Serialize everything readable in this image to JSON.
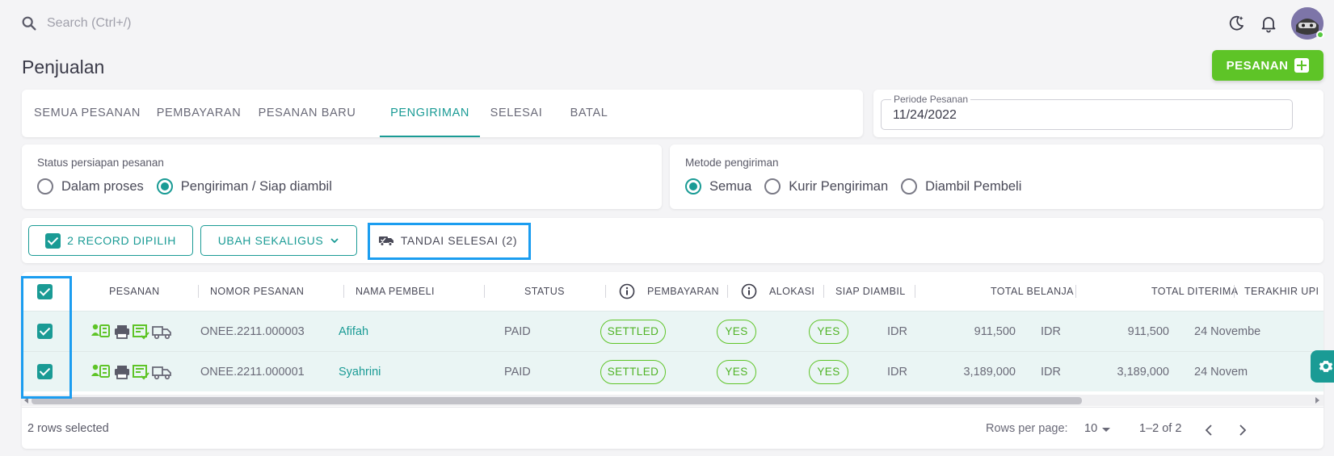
{
  "topbar": {
    "search_placeholder": "Search (Ctrl+/)",
    "icons": [
      "search-icon",
      "moon-icon",
      "bell-icon",
      "avatar"
    ]
  },
  "page": {
    "title": "Penjualan",
    "add_button_label": "PESANAN"
  },
  "tabs": [
    {
      "label": "SEMUA PESANAN",
      "active": false
    },
    {
      "label": "PEMBAYARAN",
      "active": false
    },
    {
      "label": "PESANAN BARU",
      "active": false
    },
    {
      "label": "PENGIRIMAN",
      "active": true
    },
    {
      "label": "SELESAI",
      "active": false
    },
    {
      "label": "BATAL",
      "active": false
    }
  ],
  "period": {
    "label": "Periode Pesanan",
    "value": "11/24/2022"
  },
  "status_filter": {
    "title": "Status persiapan pesanan",
    "options": [
      {
        "label": "Dalam proses",
        "checked": false
      },
      {
        "label": "Pengiriman / Siap diambil",
        "checked": true
      }
    ]
  },
  "method_filter": {
    "title": "Metode pengiriman",
    "options": [
      {
        "label": "Semua",
        "checked": true
      },
      {
        "label": "Kurir Pengiriman",
        "checked": false
      },
      {
        "label": "Diambil Pembeli",
        "checked": false
      }
    ]
  },
  "actions": {
    "selected_label": "2 RECORD DIPILIH",
    "bulk_edit_label": "UBAH SEKALIGUS",
    "mark_done_label": "TANDAI SELESAI (2)"
  },
  "table": {
    "columns": [
      "PESANAN",
      "NOMOR PESANAN",
      "NAMA PEMBELI",
      "STATUS",
      "PEMBAYARAN",
      "ALOKASI",
      "SIAP DIAMBIL",
      "TOTAL BELANJA",
      "TOTAL DITERIMA",
      "TERAKHIR UPI"
    ],
    "rows": [
      {
        "order_number": "ONEE.2211.000003",
        "buyer": "Afifah",
        "status": "PAID",
        "payment": "SETTLED",
        "allocation": "YES",
        "ready": "YES",
        "total_currency": "IDR",
        "total": "911,500",
        "received_currency": "IDR",
        "received": "911,500",
        "last_update": "24 Novembe",
        "checked": true
      },
      {
        "order_number": "ONEE.2211.000001",
        "buyer": "Syahrini",
        "status": "PAID",
        "payment": "SETTLED",
        "allocation": "YES",
        "ready": "YES",
        "total_currency": "IDR",
        "total": "3,189,000",
        "received_currency": "IDR",
        "received": "3,189,000",
        "last_update": "24 Novem",
        "checked": true
      }
    ]
  },
  "footer": {
    "selected_text": "2 rows selected",
    "rows_per_page_label": "Rows per page:",
    "rows_per_page_value": "10",
    "range_text": "1–2 of 2"
  },
  "colors": {
    "accent": "#1a9b95",
    "success": "#5ec427",
    "highlight": "#1b9df0"
  }
}
